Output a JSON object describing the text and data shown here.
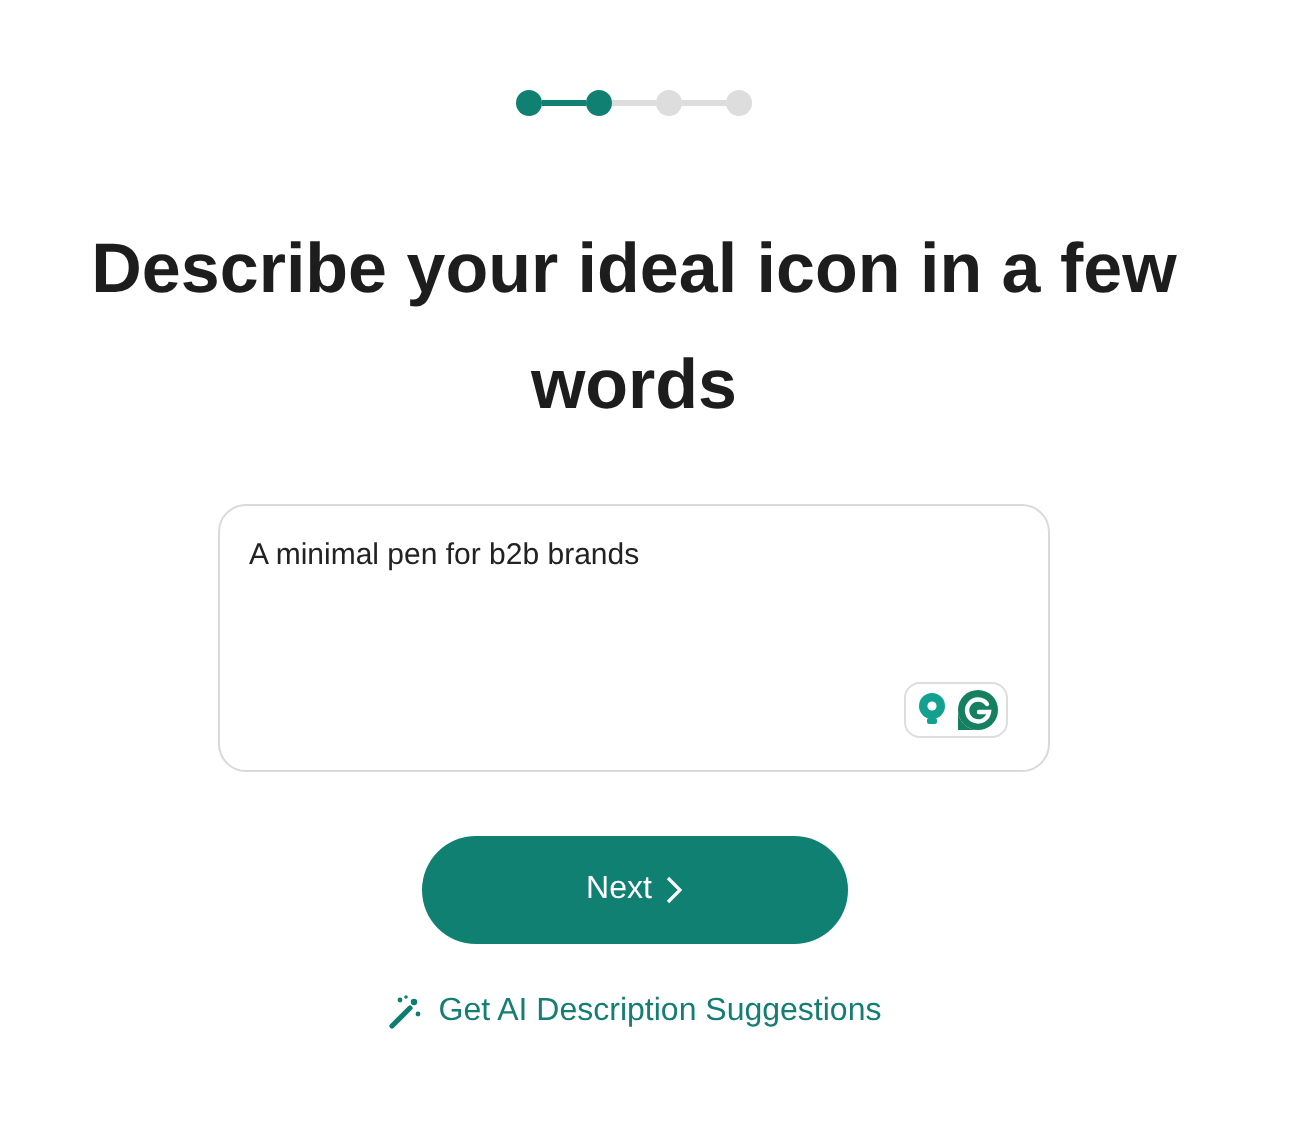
{
  "steps": [
    {
      "completed": true
    },
    {
      "completed": true
    },
    {
      "completed": false
    },
    {
      "completed": false
    }
  ],
  "heading": "Describe your ideal icon in a few words",
  "description": {
    "value": "A minimal pen for b2b brands"
  },
  "next_button": {
    "label": "Next"
  },
  "suggestions_link": {
    "label": "Get AI Description Suggestions"
  }
}
